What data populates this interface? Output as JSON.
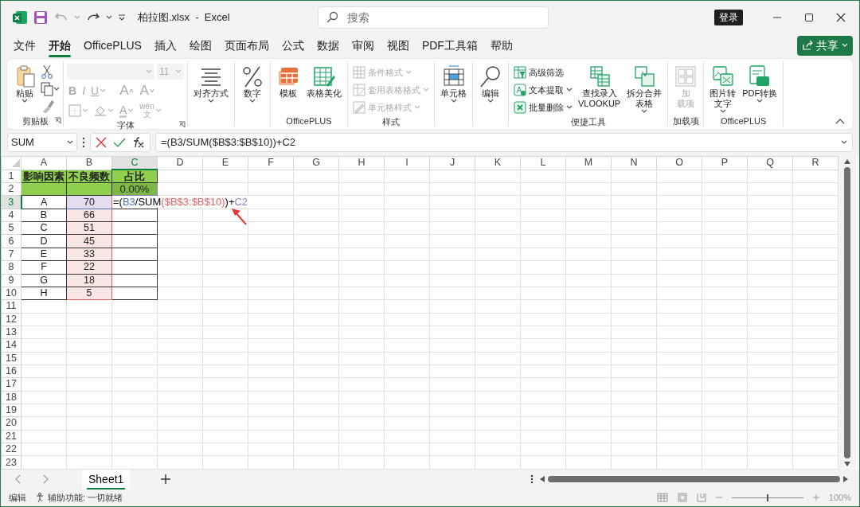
{
  "title_bar": {
    "file_title": "柏拉图.xlsx  -  Excel",
    "search_placeholder": "搜索",
    "login": "登录"
  },
  "menu_tabs": [
    {
      "label": "文件",
      "selected": false
    },
    {
      "label": "开始",
      "selected": true
    },
    {
      "label": "OfficePLUS",
      "selected": false
    },
    {
      "label": "插入",
      "selected": false
    },
    {
      "label": "绘图",
      "selected": false
    },
    {
      "label": "页面布局",
      "selected": false
    },
    {
      "label": "公式",
      "selected": false
    },
    {
      "label": "数据",
      "selected": false
    },
    {
      "label": "审阅",
      "selected": false
    },
    {
      "label": "视图",
      "selected": false
    },
    {
      "label": "PDF工具箱",
      "selected": false
    },
    {
      "label": "帮助",
      "selected": false
    }
  ],
  "share_button": "共享",
  "ribbon_groups": [
    {
      "kind": "clipboard",
      "label": "剪贴板",
      "launcher": true,
      "items": [
        {
          "kind": "large",
          "lines": [
            "粘贴"
          ],
          "dropdown": true,
          "disabled": false
        }
      ]
    },
    {
      "kind": "font",
      "label": "字体",
      "launcher": true,
      "control_lines": [
        [
          {
            "kind": "select",
            "disabled": true
          },
          {
            "kind": "size",
            "value": "11",
            "disabled": true
          }
        ],
        [
          {
            "kind": "glyph",
            "text": "B",
            "dropdown": false,
            "disabled": true
          },
          {
            "kind": "glyph",
            "text": "I",
            "dropdown": false,
            "disabled": true
          },
          {
            "kind": "glyph",
            "text": "U",
            "dropdown": true,
            "disabled": true
          },
          {
            "kind": "grow",
            "text": "A",
            "dropdown": false,
            "disabled": true
          },
          {
            "kind": "shrink",
            "text": "A",
            "dropdown": false,
            "disabled": true
          }
        ],
        [
          {
            "kind": "borders",
            "dropdown": true,
            "disabled": true
          },
          {
            "kind": "fill",
            "dropdown": true,
            "disabled": true
          },
          {
            "kind": "fontcolor",
            "text": "A",
            "dropdown": true,
            "disabled": true
          },
          {
            "kind": "phonetic",
            "text": "wén",
            "sub": "文",
            "dropdown": true,
            "disabled": true
          }
        ]
      ]
    },
    {
      "kind": "tools",
      "launcher": false,
      "items": [
        {
          "kind": "large",
          "lines": [
            "对齐方式"
          ],
          "dropdown": true,
          "disabled": false
        }
      ]
    },
    {
      "kind": "tools",
      "launcher": false,
      "items": [
        {
          "kind": "large",
          "lines": [
            "数字"
          ],
          "dropdown": true,
          "disabled": false
        }
      ]
    },
    {
      "kind": "tools",
      "label": "OfficePLUS",
      "launcher": false,
      "items": [
        {
          "kind": "large",
          "lines": [
            "模板"
          ],
          "dropdown": false,
          "disabled": false
        },
        {
          "kind": "large",
          "lines": [
            "表格美化"
          ],
          "dropdown": false,
          "disabled": false
        }
      ]
    },
    {
      "kind": "tools",
      "label": "样式",
      "launcher": false,
      "items": [
        {
          "kind": "small",
          "label": "条件格式",
          "dropdown": true,
          "disabled": true
        },
        {
          "kind": "small",
          "label": "套用表格格式",
          "dropdown": true,
          "disabled": true
        },
        {
          "kind": "small",
          "label": "单元格样式",
          "dropdown": true,
          "disabled": true
        }
      ]
    },
    {
      "kind": "tools",
      "launcher": false,
      "items": [
        {
          "kind": "large",
          "lines": [
            "单元格"
          ],
          "dropdown": true,
          "disabled": false
        }
      ]
    },
    {
      "kind": "tools",
      "launcher": false,
      "items": [
        {
          "kind": "large",
          "lines": [
            "编辑"
          ],
          "dropdown": true,
          "disabled": false
        }
      ]
    },
    {
      "kind": "tools",
      "label": "便捷工具",
      "launcher": false,
      "items": [
        {
          "kind": "small",
          "label": "高级筛选",
          "dropdown": false,
          "disabled": false
        },
        {
          "kind": "small",
          "label": "文本提取",
          "dropdown": true,
          "disabled": false
        },
        {
          "kind": "small",
          "label": "批量删除",
          "dropdown": true,
          "disabled": false
        },
        {
          "kind": "large",
          "lines": [
            "查找录入",
            "VLOOKUP"
          ],
          "dropdown": false,
          "disabled": false
        },
        {
          "kind": "large",
          "lines": [
            "拆分合并",
            "表格"
          ],
          "dropdown": true,
          "disabled": false
        }
      ]
    },
    {
      "kind": "tools",
      "label": "加载项",
      "launcher": false,
      "items": [
        {
          "kind": "large",
          "lines": [
            "加",
            "载项"
          ],
          "dropdown": false,
          "disabled": true
        }
      ]
    },
    {
      "kind": "tools",
      "label": "OfficePLUS",
      "launcher": false,
      "items": [
        {
          "kind": "large",
          "lines": [
            "图片转",
            "文字"
          ],
          "dropdown": true,
          "disabled": false
        },
        {
          "kind": "large",
          "lines": [
            "PDF转换"
          ],
          "dropdown": true,
          "disabled": false
        }
      ]
    }
  ],
  "formula_bar": {
    "name_box": "SUM",
    "formula": "=(B3/SUM($B$3:$B$10))+C2"
  },
  "columns": [
    {
      "label": "A",
      "selected": false
    },
    {
      "label": "B",
      "selected": false
    },
    {
      "label": "C",
      "selected": true
    },
    {
      "label": "D",
      "selected": false
    },
    {
      "label": "E",
      "selected": false
    },
    {
      "label": "F",
      "selected": false
    },
    {
      "label": "G",
      "selected": false
    },
    {
      "label": "H",
      "selected": false
    },
    {
      "label": "I",
      "selected": false
    },
    {
      "label": "J",
      "selected": false
    },
    {
      "label": "K",
      "selected": false
    },
    {
      "label": "L",
      "selected": false
    },
    {
      "label": "M",
      "selected": false
    },
    {
      "label": "N",
      "selected": false
    },
    {
      "label": "O",
      "selected": false
    },
    {
      "label": "P",
      "selected": false
    },
    {
      "label": "Q",
      "selected": false
    },
    {
      "label": "R",
      "selected": false
    }
  ],
  "row_numbers": [
    {
      "label": "1",
      "selected": false
    },
    {
      "label": "2",
      "selected": false
    },
    {
      "label": "3",
      "selected": true
    },
    {
      "label": "4",
      "selected": false
    },
    {
      "label": "5",
      "selected": false
    },
    {
      "label": "6",
      "selected": false
    },
    {
      "label": "7",
      "selected": false
    },
    {
      "label": "8",
      "selected": false
    },
    {
      "label": "9",
      "selected": false
    },
    {
      "label": "10",
      "selected": false
    },
    {
      "label": "11",
      "selected": false
    },
    {
      "label": "12",
      "selected": false
    },
    {
      "label": "13",
      "selected": false
    },
    {
      "label": "14",
      "selected": false
    },
    {
      "label": "15",
      "selected": false
    },
    {
      "label": "16",
      "selected": false
    },
    {
      "label": "17",
      "selected": false
    },
    {
      "label": "18",
      "selected": false
    },
    {
      "label": "19",
      "selected": false
    },
    {
      "label": "20",
      "selected": false
    },
    {
      "label": "21",
      "selected": false
    },
    {
      "label": "22",
      "selected": false
    },
    {
      "label": "23",
      "selected": false
    }
  ],
  "data_rows": [
    {
      "cells": [
        {
          "kind": "header",
          "text": "影响因素",
          "referenced": false
        },
        {
          "kind": "header",
          "text": "不良频数",
          "referenced": false
        },
        {
          "kind": "header",
          "text": "占比",
          "referenced": false
        }
      ]
    },
    {
      "cells": [
        {
          "kind": "header",
          "referenced": false
        },
        {
          "kind": "header",
          "referenced": false
        },
        {
          "kind": "header",
          "text": "0.00%",
          "referenced": true
        }
      ]
    },
    {
      "cells": [
        {
          "kind": "value",
          "text": "A",
          "referenced": false
        },
        {
          "kind": "value",
          "text": "70",
          "referenced": true
        },
        {
          "kind": "editing",
          "segments": [
            {
              "text": "=(",
              "color": "#000000"
            },
            {
              "text": "B3",
              "color": "#4472c4"
            },
            {
              "text": "/SUM",
              "color": "#000000"
            },
            {
              "text": "($B$3:$B$10)",
              "color": "#e06666"
            },
            {
              "text": ")+",
              "color": "#000000"
            },
            {
              "text": "C2",
              "color": "#8e7cc3"
            }
          ]
        }
      ]
    },
    {
      "cells": [
        {
          "kind": "value",
          "text": "B",
          "referenced": false
        },
        {
          "kind": "value",
          "text": "66",
          "referenced": true
        },
        {
          "kind": "value",
          "referenced": false
        }
      ]
    },
    {
      "cells": [
        {
          "kind": "value",
          "text": "C",
          "referenced": false
        },
        {
          "kind": "value",
          "text": "51",
          "referenced": true
        },
        {
          "kind": "value",
          "referenced": false
        }
      ]
    },
    {
      "cells": [
        {
          "kind": "value",
          "text": "D",
          "referenced": false
        },
        {
          "kind": "value",
          "text": "45",
          "referenced": true
        },
        {
          "kind": "value",
          "referenced": false
        }
      ]
    },
    {
      "cells": [
        {
          "kind": "value",
          "text": "E",
          "referenced": false
        },
        {
          "kind": "value",
          "text": "33",
          "referenced": true
        },
        {
          "kind": "value",
          "referenced": false
        }
      ]
    },
    {
      "cells": [
        {
          "kind": "value",
          "text": "F",
          "referenced": false
        },
        {
          "kind": "value",
          "text": "22",
          "referenced": true
        },
        {
          "kind": "value",
          "referenced": false
        }
      ]
    },
    {
      "cells": [
        {
          "kind": "value",
          "text": "G",
          "referenced": false
        },
        {
          "kind": "value",
          "text": "18",
          "referenced": true
        },
        {
          "kind": "value",
          "referenced": false
        }
      ]
    },
    {
      "cells": [
        {
          "kind": "value",
          "text": "H",
          "referenced": false
        },
        {
          "kind": "value",
          "text": "5",
          "referenced": true
        },
        {
          "kind": "value",
          "referenced": false
        }
      ]
    }
  ],
  "sheet_tabs": [
    {
      "label": "Sheet1",
      "selected": true
    }
  ],
  "status_bar": {
    "mode": "编辑",
    "accessibility": "辅助功能: 一切就绪",
    "zoom": "100%",
    "zoom_slider": {
      "level": 0.5
    }
  }
}
